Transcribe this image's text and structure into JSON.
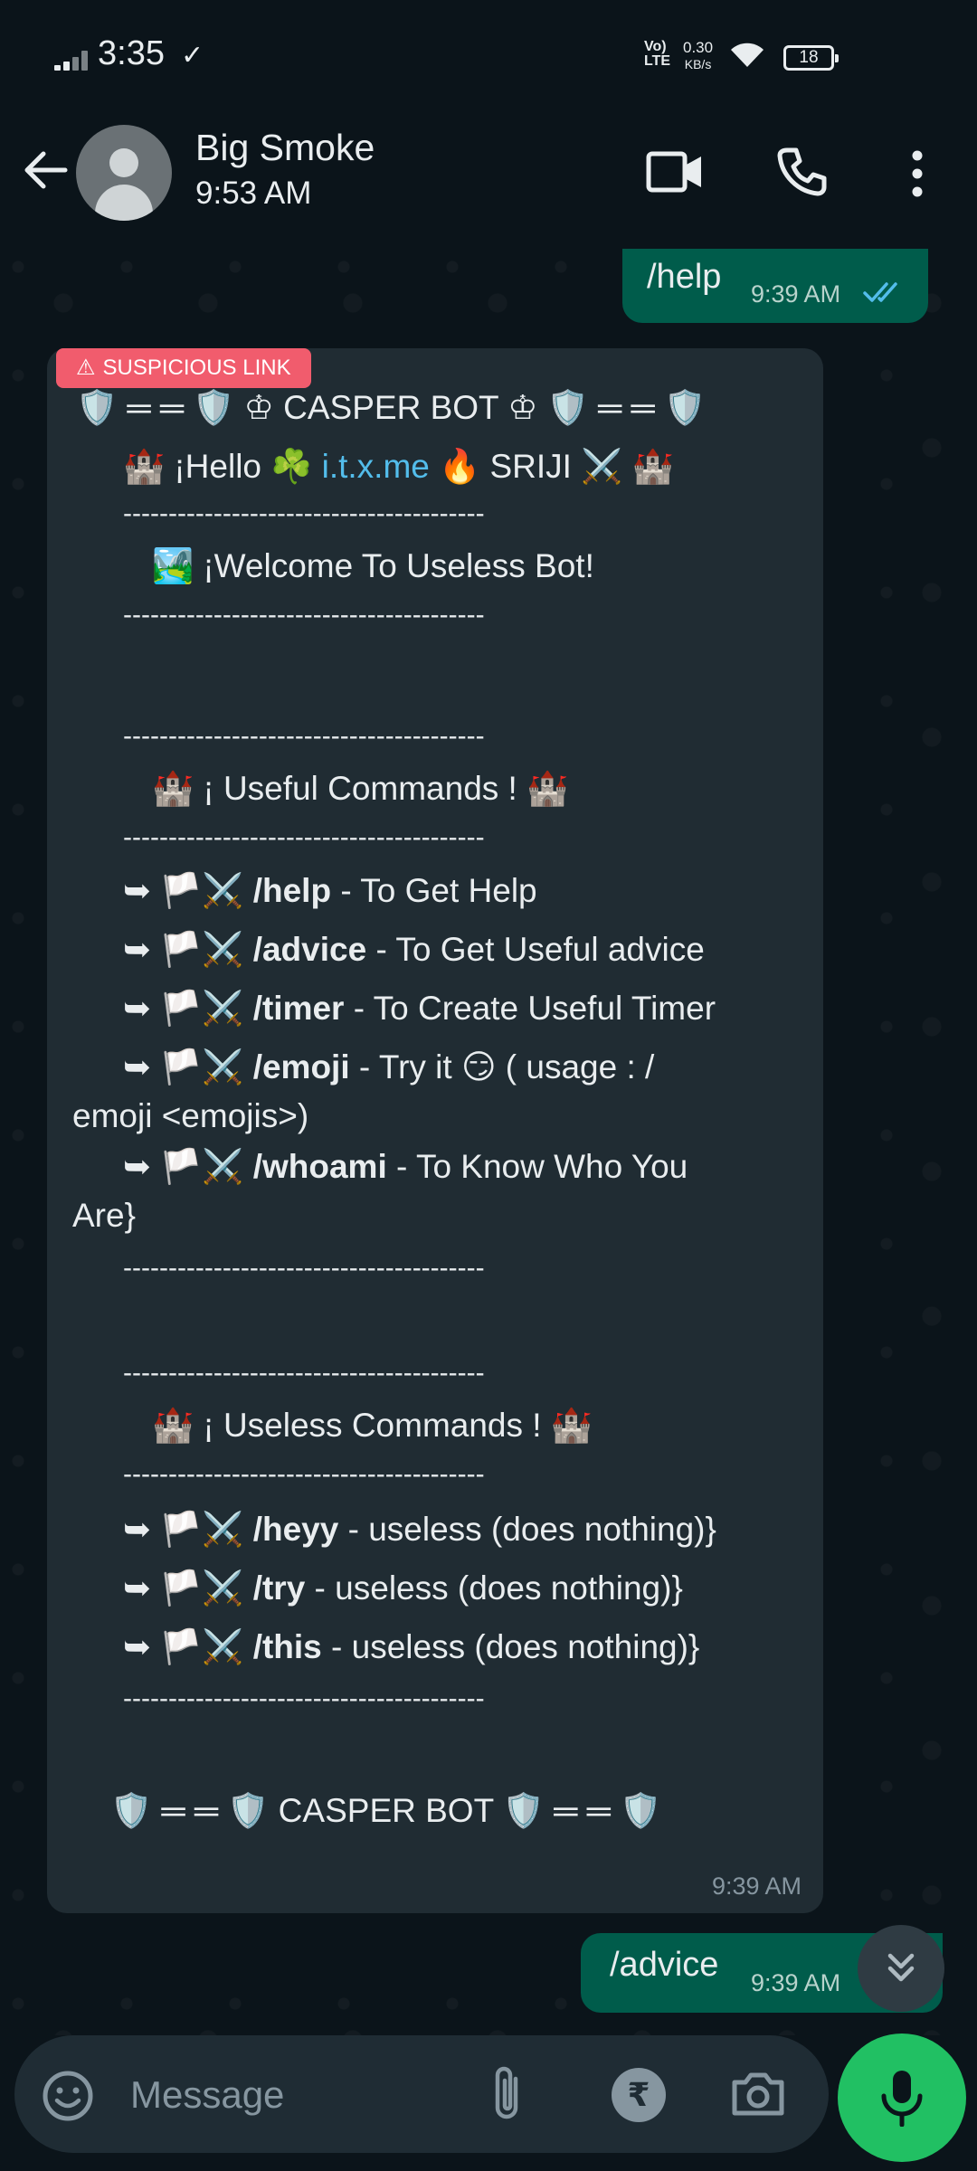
{
  "status_bar": {
    "time": "3:35",
    "check": "✓",
    "lte": "Vo) LTE",
    "speed_value": "0.30",
    "speed_unit": "KB/s",
    "battery": "18"
  },
  "header": {
    "contact_name": "Big Smoke",
    "subtitle": "9:53 AM"
  },
  "messages": {
    "out_help": {
      "text": "/help",
      "time": "9:39 AM"
    },
    "incoming": {
      "badge": "SUSPICIOUS LINK",
      "time": "9:39 AM",
      "lines": {
        "title": "🛡️ ═ ═ 🛡️ ♔ CASPER BOT ♔ 🛡️ ═ ═ 🛡️",
        "hello_pre": "🏰 ¡Hello ☘️ ",
        "hello_link": "i.t.x.me",
        "hello_post": " 🔥 SRIJI ⚔️ 🏰",
        "sep": "----------------------------------------",
        "welcome": "🏞️ ¡Welcome To Useless Bot!",
        "useful_header": "🏰 ¡ Useful Commands ! 🏰",
        "arrow": "➥ 🏳️⚔️",
        "help_cmd": "/help",
        "help_desc": " - To Get Help",
        "advice_cmd": "/advice",
        "advice_desc": " - To Get Useful advice",
        "timer_cmd": "/timer",
        "timer_desc": " - To Create Useful Timer",
        "emoji_cmd": "/emoji",
        "emoji_desc": "  - Try it 😏 ( usage : /",
        "emoji_cont": "emoji <emojis>)",
        "whoami_cmd": "/whoami",
        "whoami_desc": "  - To Know Who You",
        "whoami_cont": "Are}",
        "useless_header": "🏰 ¡ Useless Commands ! 🏰",
        "heyy_cmd": "/heyy",
        "heyy_desc": " - useless (does nothing)}",
        "try_cmd": "/try",
        "try_desc": " - useless (does nothing)}",
        "this_cmd": "/this",
        "this_desc": " - useless (does nothing)}",
        "footer": "🛡️ ═ ═ 🛡️ CASPER BOT 🛡️ ═ ═ 🛡️"
      }
    },
    "out_advice": {
      "text": "/advice",
      "time": "9:39 AM"
    }
  },
  "input": {
    "placeholder": "Message",
    "rupee": "₹"
  },
  "colors": {
    "background": "#0b141a",
    "outgoing_bubble": "#005c4b",
    "incoming_bubble": "#202c33",
    "suspicious_badge": "#f15c6d",
    "link": "#53bdeb",
    "mic_button": "#21c063",
    "read_ticks": "#53bdeb"
  },
  "icons": {
    "back": "back-arrow-icon",
    "video": "video-call-icon",
    "call": "phone-call-icon",
    "more": "more-vert-icon",
    "emoji": "emoji-icon",
    "attach": "paperclip-icon",
    "rupee": "rupee-payment-icon",
    "camera": "camera-icon",
    "mic": "mic-icon",
    "scroll": "double-chevron-down-icon"
  }
}
